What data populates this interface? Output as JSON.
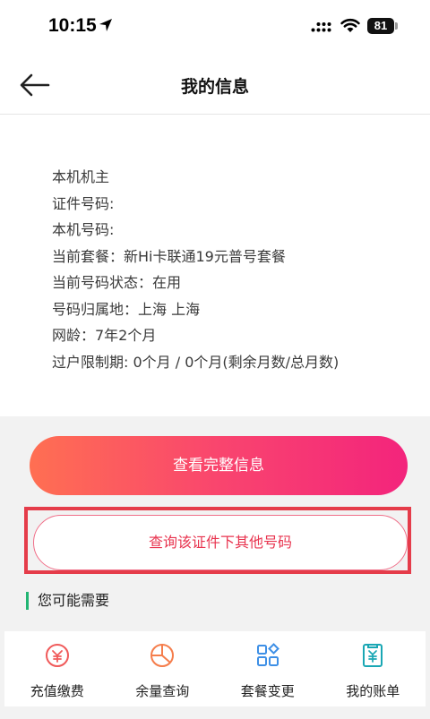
{
  "status_bar": {
    "time": "10:15",
    "battery": "81"
  },
  "header": {
    "title": "我的信息",
    "back_icon": "back-arrow-icon"
  },
  "info": {
    "lines": [
      "本机机主",
      "证件号码:",
      "本机号码:",
      "当前套餐：新Hi卡联通19元普号套餐",
      "当前号码状态：在用",
      "号码归属地：上海 上海",
      "网龄：7年2个月",
      "过户限制期: 0个月 / 0个月(剩余月数/总月数)"
    ]
  },
  "actions": {
    "view_full_label": "查看完整信息",
    "query_other_label": "查询该证件下其他号码"
  },
  "section": {
    "title": "您可能需要"
  },
  "shortcuts": [
    {
      "label": "充值缴费",
      "icon": "recharge-icon"
    },
    {
      "label": "余量查询",
      "icon": "pie-chart-icon"
    },
    {
      "label": "套餐变更",
      "icon": "grid-icon"
    },
    {
      "label": "我的账单",
      "icon": "bill-icon"
    }
  ],
  "colors": {
    "accent": "#f9456e",
    "gradient_start": "#ff6f52",
    "gradient_end": "#f3247c",
    "highlight_border": "#e53c4a",
    "section_bar": "#22b573",
    "icon_red": "#f05a5a",
    "icon_orange": "#f57d4b",
    "icon_blue": "#3d8fe6",
    "icon_teal": "#1aa7b4"
  }
}
